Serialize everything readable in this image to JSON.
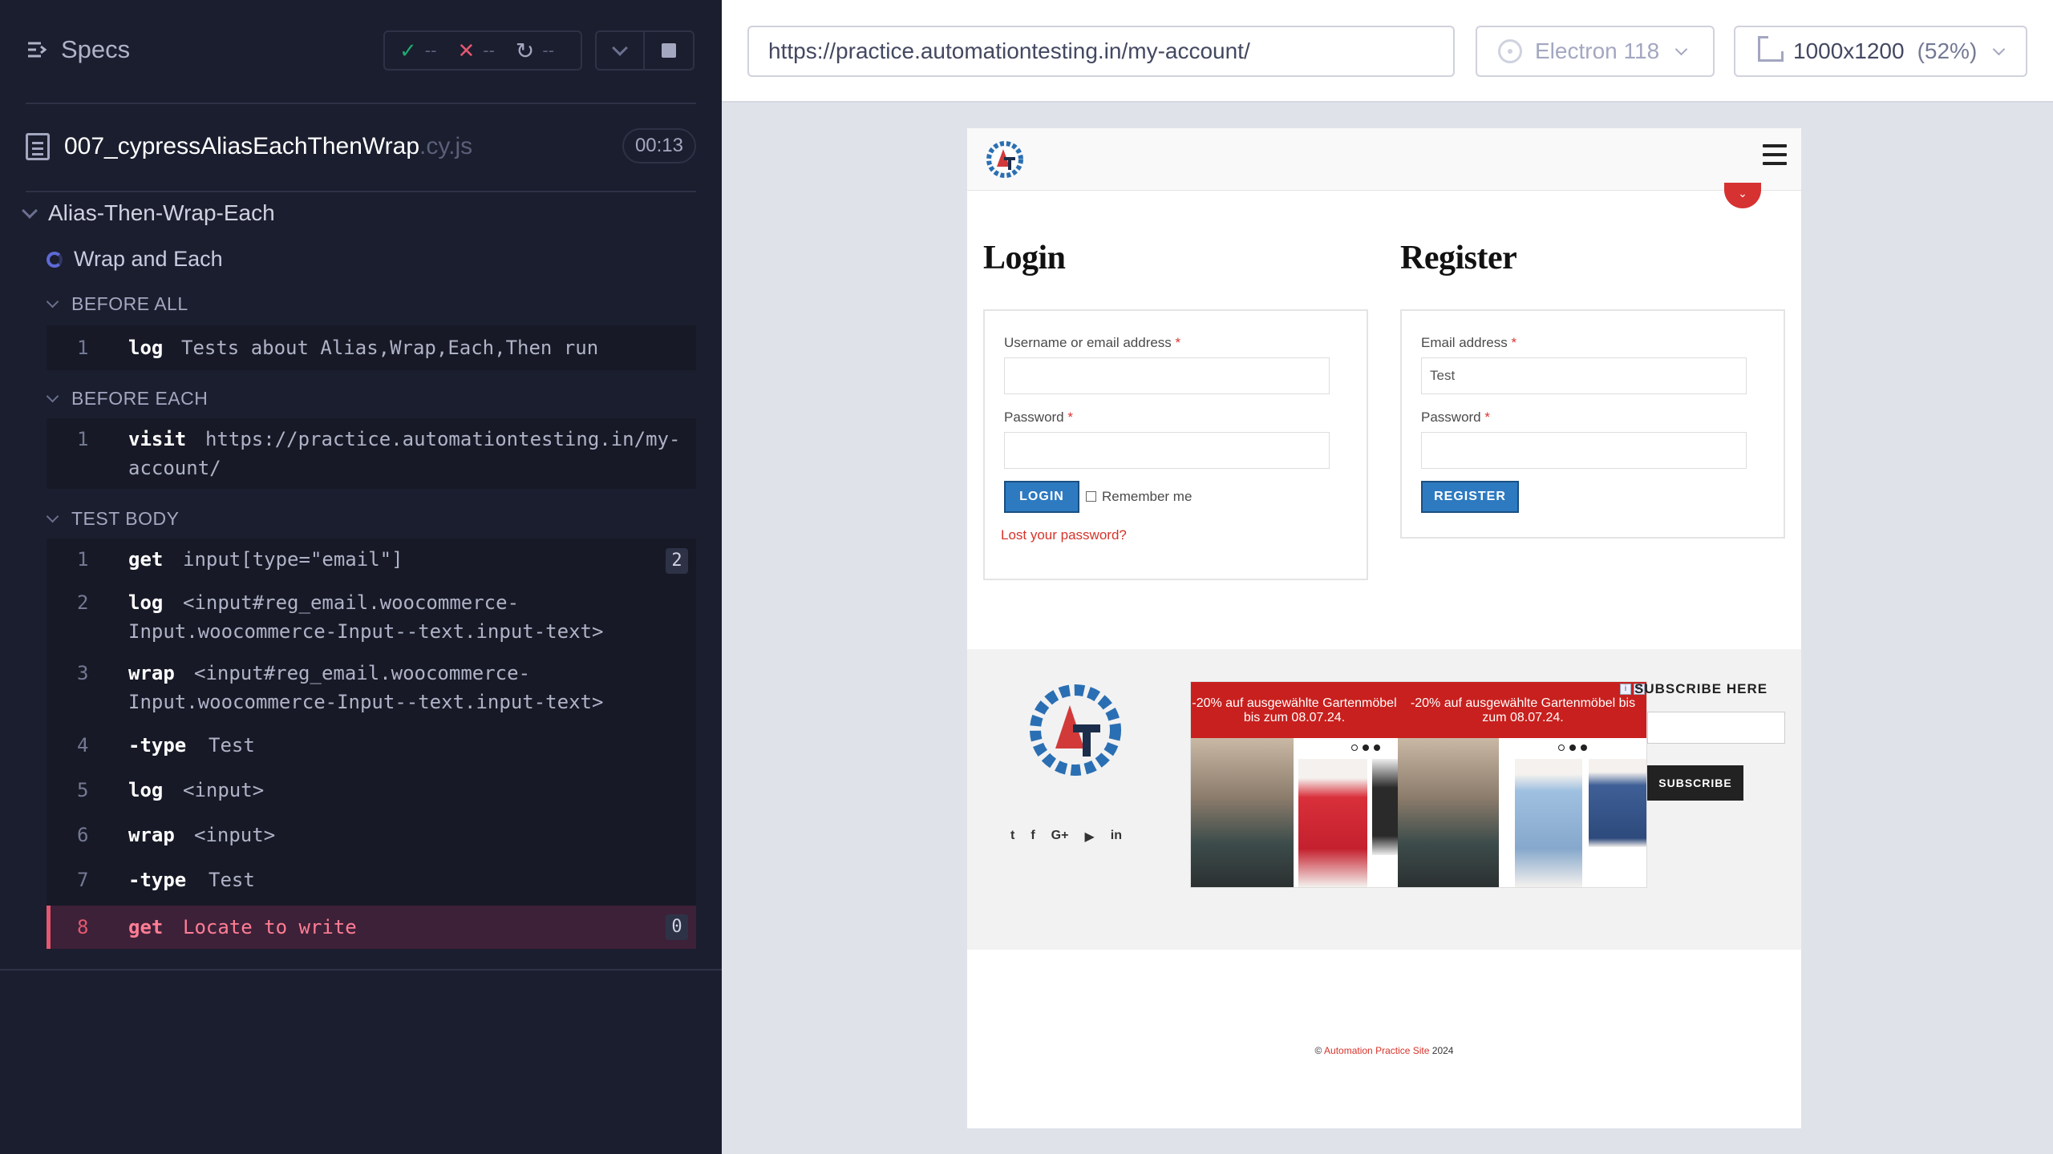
{
  "reporter": {
    "specs_label": "Specs",
    "stats": {
      "passed": "--",
      "failed": "--",
      "pending": "--"
    },
    "spec": {
      "name": "007_cypressAliasEachThenWrap",
      "ext": ".cy.js",
      "duration": "00:13"
    },
    "suite_title": "Alias-Then-Wrap-Each",
    "test_title": "Wrap and Each",
    "hooks": [
      {
        "title": "BEFORE ALL",
        "commands": [
          {
            "num": "1",
            "name": "log",
            "message": "Tests about Alias,Wrap,Each,Then run"
          }
        ]
      },
      {
        "title": "BEFORE EACH",
        "commands": [
          {
            "num": "1",
            "name": "visit",
            "message": "https://practice.automationtesting.in/my-",
            "message2": "account/"
          }
        ]
      },
      {
        "title": "TEST BODY",
        "commands": [
          {
            "num": "1",
            "name": "get",
            "message": "input[type=\"email\"]",
            "badge": "2"
          },
          {
            "num": "2",
            "name": "log",
            "message": "<input#reg_email.woocommerce-",
            "message2": "Input.woocommerce-Input--text.input-text>"
          },
          {
            "num": "3",
            "name": "wrap",
            "message": "<input#reg_email.woocommerce-",
            "message2": "Input.woocommerce-Input--text.input-text>"
          },
          {
            "num": "4",
            "name": "-type",
            "message": "Test"
          },
          {
            "num": "5",
            "name": "log",
            "message": "<input>"
          },
          {
            "num": "6",
            "name": "wrap",
            "message": "<input>"
          },
          {
            "num": "7",
            "name": "-type",
            "message": "Test"
          },
          {
            "num": "8",
            "name": "get",
            "message": "Locate to write",
            "badge": "0"
          }
        ]
      }
    ]
  },
  "browser": {
    "url": "https://practice.automationtesting.in/my-account/",
    "browser_name": "Electron 118",
    "viewport": "1000x1200",
    "scale": "(52%)"
  },
  "site": {
    "login": {
      "title": "Login",
      "username_label": "Username or email address",
      "password_label": "Password",
      "required_mark": "*",
      "login_button": "LOGIN",
      "remember_label": "Remember me",
      "lost_password": "Lost your password?"
    },
    "register": {
      "title": "Register",
      "email_label": "Email address",
      "email_value": "Test",
      "password_label": "Password",
      "required_mark": "*",
      "register_button": "REGISTER"
    },
    "footer": {
      "ad_text_1": "-20% auf ausgewählte Gartenmöbel bis zum 08.07.24.",
      "ad_text_2": "-20% auf ausgewählte Gartenmöbel bis zum 08.07.24.",
      "subscribe_title": "SUBSCRIBE HERE",
      "subscribe_button": "SUBSCRIBE",
      "copyright_prefix": "©",
      "copyright_link": "Automation Practice Site",
      "copyright_year": "2024",
      "social_icons": [
        "twitter-icon",
        "facebook-icon",
        "google-plus-icon",
        "youtube-icon",
        "linkedin-icon"
      ],
      "social_glyphs": [
        "t",
        "f",
        "G+",
        "▶",
        "in"
      ]
    }
  },
  "colors": {
    "reporter_bg": "#1b1e2e",
    "failed": "#e45770",
    "passed": "#1fa971",
    "site_button": "#2d7ac1",
    "site_red": "#d6332a"
  }
}
